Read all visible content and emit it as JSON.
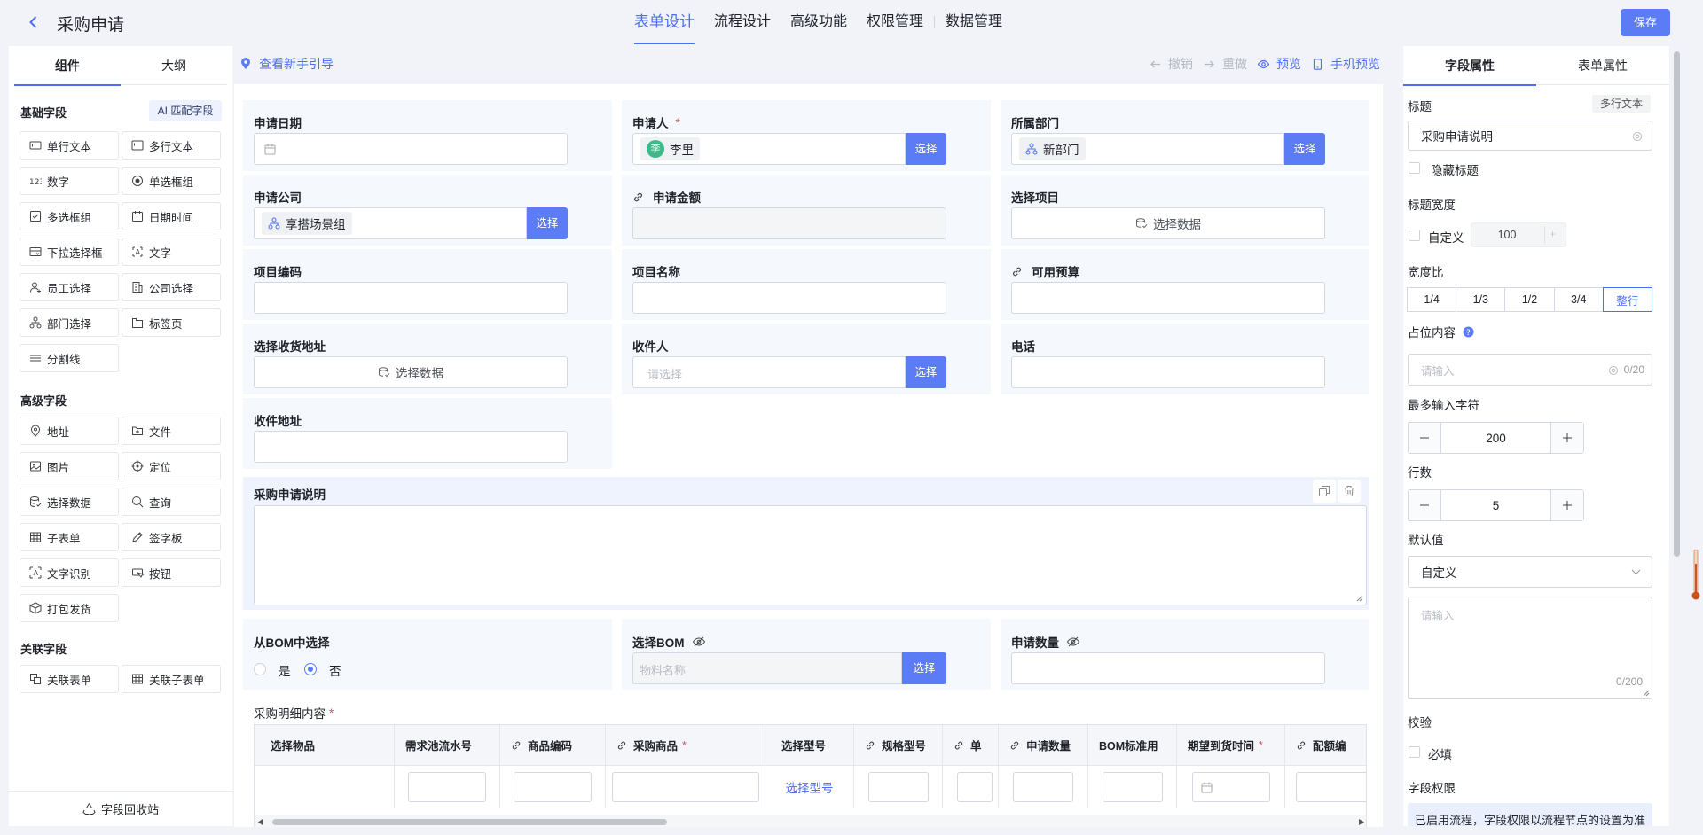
{
  "header": {
    "title": "采购申请",
    "nav": [
      "表单设计",
      "流程设计",
      "高级功能",
      "权限管理",
      "数据管理"
    ],
    "save": "保存"
  },
  "left": {
    "tabs": [
      "组件",
      "大纲"
    ],
    "basic_title": "基础字段",
    "match_label": "AI 匹配字段",
    "basic": [
      "单行文本",
      "多行文本",
      "数字",
      "单选框组",
      "多选框组",
      "日期时间",
      "下拉选择框",
      "文字",
      "员工选择",
      "公司选择",
      "部门选择",
      "标签页",
      "分割线"
    ],
    "advanced_title": "高级字段",
    "advanced": [
      "地址",
      "文件",
      "图片",
      "定位",
      "选择数据",
      "查询",
      "子表单",
      "签字板",
      "文字识别",
      "按钮",
      "打包发货"
    ],
    "related_title": "关联字段",
    "related": [
      "关联表单",
      "关联子表单"
    ],
    "recycle": "字段回收站"
  },
  "toolbar": {
    "guide": "查看新手引导",
    "undo": "撤销",
    "redo": "重做",
    "preview": "预览",
    "mobile_preview": "手机预览"
  },
  "form": {
    "apply_date": "申请日期",
    "applicant": "申请人",
    "applicant_value": "李里",
    "applicant_avatar": "李",
    "dept": "所属部门",
    "dept_value": "新部门",
    "company": "申请公司",
    "company_value": "享搭场景组",
    "amount": "申请金额",
    "project": "选择项目",
    "select_data": "选择数据",
    "project_code": "项目编码",
    "project_name": "项目名称",
    "budget": "可用预算",
    "address_select": "选择收货地址",
    "receiver": "收件人",
    "receiver_placeholder": "请选择",
    "phone": "电话",
    "recv_address": "收件地址",
    "desc": "采购申请说明",
    "bom_from": "从BOM中选择",
    "yes": "是",
    "no": "否",
    "bom_select": "选择BOM",
    "bom_placeholder": "物料名称",
    "apply_qty": "申请数量",
    "select_btn": "选择",
    "detail_title": "采购明细内容",
    "columns": [
      "选择物品",
      "需求池流水号",
      "商品编码",
      "采购商品",
      "选择型号",
      "规格型号",
      "单",
      "申请数量",
      "BOM标准用",
      "期望到货时间",
      "配额编"
    ],
    "row_link": "选择型号"
  },
  "right": {
    "tabs": [
      "字段属性",
      "表单属性"
    ],
    "title_label": "标题",
    "type_badge": "多行文本",
    "title_value": "采购申请说明",
    "hide_title": "隐藏标题",
    "title_width": "标题宽度",
    "custom": "自定义",
    "width_value": "100",
    "ratio_label": "宽度比",
    "ratios": [
      "1/4",
      "1/3",
      "1/2",
      "3/4",
      "整行"
    ],
    "placeholder_label": "占位内容",
    "placeholder_hint": "请输入",
    "placeholder_count": "0/20",
    "maxlen_label": "最多输入字符",
    "maxlen": "200",
    "rows_label": "行数",
    "rows": "5",
    "default_label": "默认值",
    "default_value": "自定义",
    "default_hint": "请输入",
    "default_count": "0/200",
    "validate_label": "校验",
    "required": "必填",
    "perm_label": "字段权限",
    "perm_note": "已启用流程，字段权限以流程节点的设置为准"
  },
  "colors": {
    "accent": "#4e6ef2",
    "button": "#5b7cf5",
    "required": "#e34d59"
  }
}
